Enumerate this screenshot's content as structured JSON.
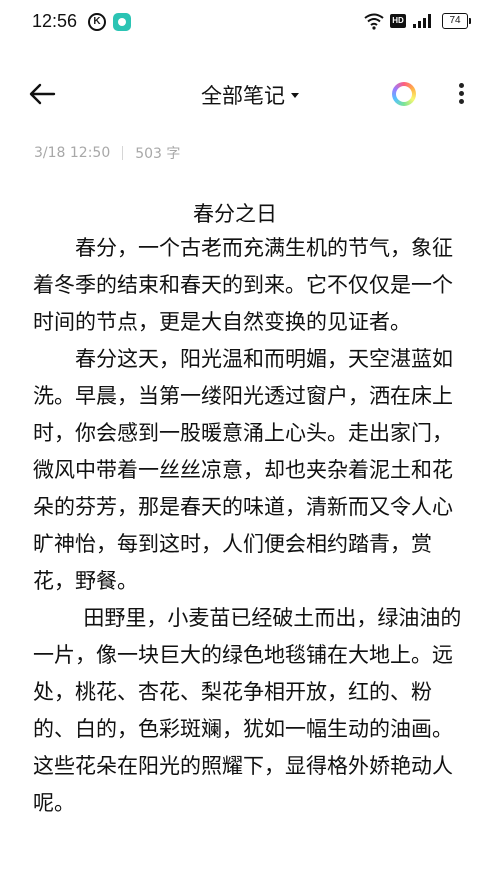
{
  "status_bar": {
    "time": "12:56",
    "k_badge": "K",
    "network": "HD",
    "battery": "74"
  },
  "toolbar": {
    "title": "全部笔记",
    "back_icon": "arrow-left-icon",
    "theme_icon": "color-ring-icon",
    "more_icon": "more-vertical-icon"
  },
  "note": {
    "date": "3/18 12:50",
    "word_count": "503 字",
    "title": "春分之日",
    "paragraphs": [
      "春分，一个古老而充满生机的节气，象征着冬季的结束和春天的到来。它不仅仅是一个时间的节点，更是大自然变换的见证者。",
      "春分这天，阳光温和而明媚，天空湛蓝如洗。早晨，当第一缕阳光透过窗户，洒在床上时，你会感到一股暖意涌上心头。走出家门，微风中带着一丝丝凉意，却也夹杂着泥土和花朵的芬芳，那是春天的味道，清新而又令人心旷神怡，每到这时，人们便会相约踏青，赏花，野餐。",
      "田野里，小麦苗已经破土而出，绿油油的一片，像一块巨大的绿色地毯铺在大地上。远处，桃花、杏花、梨花争相开放，红的、粉的、白的，色彩斑斓，犹如一幅生动的油画。这些花朵在阳光的照耀下，显得格外娇艳动人呢。"
    ]
  },
  "colors": {
    "text": "#111111",
    "meta": "#a8a8a8",
    "background": "#ffffff"
  }
}
